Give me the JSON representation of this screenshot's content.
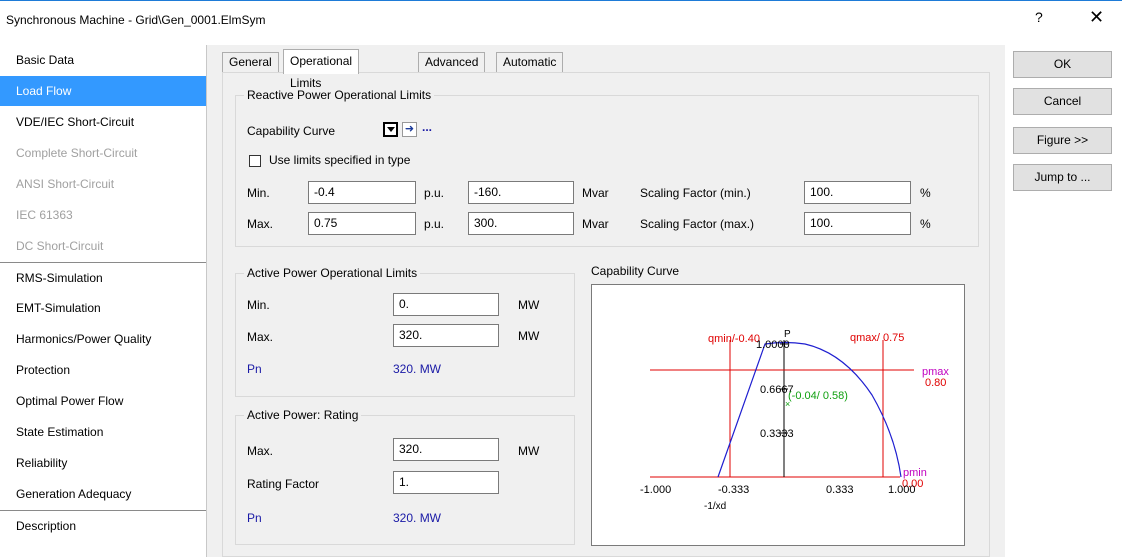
{
  "window": {
    "title": "Synchronous Machine - Grid\\Gen_0001.ElmSym",
    "help": "?",
    "close": "✕"
  },
  "sidebar": {
    "items": [
      {
        "label": "Basic Data"
      },
      {
        "label": "Load Flow"
      },
      {
        "label": "VDE/IEC Short-Circuit"
      },
      {
        "label": "Complete Short-Circuit"
      },
      {
        "label": "ANSI Short-Circuit"
      },
      {
        "label": "IEC 61363"
      },
      {
        "label": "DC Short-Circuit"
      },
      {
        "label": "RMS-Simulation"
      },
      {
        "label": "EMT-Simulation"
      },
      {
        "label": "Harmonics/Power Quality"
      },
      {
        "label": "Protection"
      },
      {
        "label": "Optimal Power Flow"
      },
      {
        "label": "State Estimation"
      },
      {
        "label": "Reliability"
      },
      {
        "label": "Generation Adequacy"
      },
      {
        "label": "Description"
      }
    ]
  },
  "tabs": [
    "General",
    "Operational Limits",
    "Advanced",
    "Automatic Dispatch"
  ],
  "reactive": {
    "title": "Reactive Power Operational Limits",
    "capability_label": "Capability Curve",
    "ellipsis": "...",
    "use_limits_label": "Use limits specified in type",
    "use_limits_checked": false,
    "min_label": "Min.",
    "max_label": "Max.",
    "min_pu": "-0.4",
    "max_pu": "0.75",
    "pu_unit": "p.u.",
    "min_mvar": "-160.",
    "max_mvar": "300.",
    "mvar_unit": "Mvar",
    "scaling_min_label": "Scaling Factor (min.)",
    "scaling_max_label": "Scaling Factor (max.)",
    "scaling_min": "100.",
    "scaling_max": "100.",
    "percent": "%"
  },
  "active_limits": {
    "title": "Active Power Operational Limits",
    "min_label": "Min.",
    "max_label": "Max.",
    "min_value": "0.",
    "max_value": "320.",
    "unit": "MW",
    "pn_label": "Pn",
    "pn_value": "320. MW"
  },
  "rating": {
    "title": "Active Power: Rating",
    "max_label": "Max.",
    "max_value": "320.",
    "unit": "MW",
    "factor_label": "Rating Factor",
    "factor_value": "1.",
    "pn_label": "Pn",
    "pn_value": "320. MW"
  },
  "capability_plot": {
    "title": "Capability Curve",
    "qmin_label": "qmin/-0.40",
    "qmax_label": "qmax/ 0.75",
    "p_label": "P",
    "p_top_tick": "1.0000",
    "tick_0667": "0.6667",
    "tick_0333": "0.3333",
    "point_label": "(-0.04/ 0.58)",
    "pmax_label": "pmax",
    "pmax_value": "0.80",
    "pmin_label": "pmin",
    "pmin_value": "0.00",
    "x_ticks": [
      "-1.000",
      "-0.333",
      "0.333",
      "1.000"
    ],
    "xd_label": "-1/xd"
  },
  "buttons": {
    "ok": "OK",
    "cancel": "Cancel",
    "figure": "Figure >>",
    "jump": "Jump to ..."
  }
}
